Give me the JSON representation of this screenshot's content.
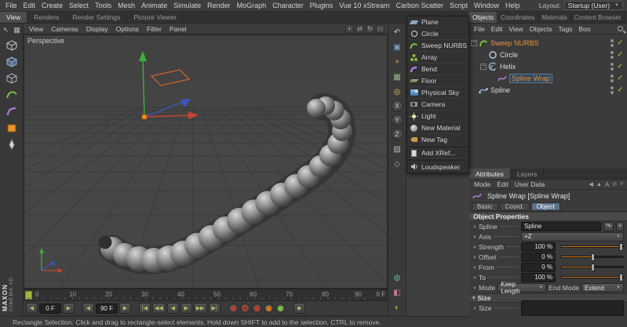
{
  "colors": {
    "accent_orange": "#e8942c",
    "selection_blue": "#31475c",
    "check_green": "#7cbf3f",
    "timeline_green": "#9db83c",
    "axis_red": "#c44436",
    "axis_green": "#3fae3c",
    "axis_blue": "#3a56c4"
  },
  "icons": {
    "check": "✓",
    "dropdown_arrow": "▼",
    "collapse": "−",
    "triangle_down": "▾",
    "left_arrow": "◀",
    "right_arrow": "▶",
    "goto_start": "|◀",
    "rewind": "◀◀",
    "play": "▶",
    "forward": "▶▶",
    "goto_end": "▶|",
    "undo": "↶",
    "pick_arrow": "↷",
    "diamond": "◆"
  },
  "menubar": {
    "items": [
      "File",
      "Edit",
      "Create",
      "Select",
      "Tools",
      "Mesh",
      "Animate",
      "Simulate",
      "Render",
      "MoGraph",
      "Character",
      "Plugins",
      "Vue 10 xStream",
      "Carbon Scatter",
      "Script",
      "Window",
      "Help"
    ],
    "layout_label": "Layout:",
    "layout_value": "Startup (User)"
  },
  "workspace_tabs": [
    "View",
    "Renders",
    "Render Settings",
    "Picture Viewer"
  ],
  "panel_tabs": [
    "Objects",
    "Coordinates",
    "Materials",
    "Content Browser"
  ],
  "viewport": {
    "menu": [
      "View",
      "Cameras",
      "Display",
      "Options",
      "Filter",
      "Panel"
    ],
    "camera_label": "Perspective",
    "toolbar_icons": [
      "move-view-icon",
      "pan-view-icon",
      "rotate-view-icon",
      "maximize-view-icon"
    ]
  },
  "left_toolbar": [
    "convert-object-icon",
    "cube-primitive-icon",
    "modeling-object-icon",
    "nurbs-object-icon",
    "deformer-object-icon",
    "scene-object-icon",
    "spline-pen-icon"
  ],
  "side_toolbar": {
    "icons": [
      "undo-icon",
      "frame-selection-icon",
      "add-object-icon",
      "grid-icon",
      "snap-icon",
      "texture-mode-icon",
      "axis-mode-icon",
      "camera-icon",
      "display-mode-icon",
      "render-region-icon"
    ],
    "axis_locks": [
      "X",
      "Y",
      "Z"
    ]
  },
  "popup_menu": {
    "items": [
      {
        "label": "Plane",
        "icon": "plane-icon"
      },
      {
        "label": "Circle",
        "icon": "circle-icon"
      },
      {
        "label": "Sweep NURBS",
        "icon": "sweep-nurbs-icon"
      },
      {
        "label": "Array",
        "icon": "array-icon"
      },
      {
        "label": "Bend",
        "icon": "bend-icon"
      },
      {
        "label": "Floor",
        "icon": "floor-icon"
      },
      {
        "label": "Physical Sky",
        "icon": "physical-sky-icon"
      },
      {
        "label": "Camera",
        "icon": "camera-icon"
      },
      {
        "label": "Light",
        "icon": "light-icon"
      },
      {
        "label": "New Material",
        "icon": "material-icon"
      },
      {
        "label": "New Tag",
        "icon": "tag-icon"
      },
      {
        "label": "Add XRef...",
        "icon": "xref-icon"
      },
      {
        "label": "Loudspeaker",
        "icon": "loudspeaker-icon"
      }
    ]
  },
  "object_manager": {
    "menu": [
      "File",
      "Edit",
      "View",
      "Objects",
      "Tags",
      "Boo"
    ],
    "tree": [
      {
        "label": "Sweep NURBS",
        "icon": "sweep-nurbs-icon",
        "depth": 0,
        "selected": true,
        "enabled": "check"
      },
      {
        "label": "Circle",
        "icon": "circle-icon",
        "depth": 1,
        "selected": false,
        "enabled": "check"
      },
      {
        "label": "Helix",
        "icon": "helix-icon",
        "depth": 1,
        "selected": false,
        "enabled": "check"
      },
      {
        "label": "Spline Wrap",
        "icon": "spline-wrap-icon",
        "depth": 2,
        "selected": true,
        "enabled": "check"
      },
      {
        "label": "Spline",
        "icon": "spline-icon",
        "depth": 0,
        "selected": false,
        "enabled": "check"
      }
    ]
  },
  "attributes": {
    "tabs": [
      "Attributes",
      "Layers"
    ],
    "menu": [
      "Mode",
      "Edit",
      "User Data"
    ],
    "title": "Spline Wrap [Spline Wrap]",
    "subtabs": [
      "Basic",
      "Coord.",
      "Object"
    ],
    "active_subtab": "Object",
    "section": "Object Properties",
    "fields": {
      "spline_label": "Spline",
      "spline_value": "Spline",
      "axis_label": "Axis",
      "axis_value": "+Z",
      "strength_label": "Strength",
      "strength_value": "100 %",
      "offset_label": "Offset",
      "offset_value": "0 %",
      "from_label": "From",
      "from_value": "0 %",
      "to_label": "To",
      "to_value": "100 %",
      "mode_label": "Mode",
      "mode_value": "Keep Length",
      "end_mode_label": "End Mode",
      "end_mode_value": "Extend",
      "size_section": "Size",
      "size_label": "Size"
    }
  },
  "timeline": {
    "ticks": [
      "0",
      "10",
      "20",
      "30",
      "40",
      "50",
      "60",
      "70",
      "80",
      "90"
    ],
    "end_label": "0 F",
    "current_frame": "0 F",
    "end_frame": "90 F"
  },
  "statusbar": {
    "text": "Rectangle Selection: Click and drag to rectangle-select elements. Hold down SHIFT to add to the selection, CTRL to remove."
  },
  "brand": {
    "line1": "MAXON",
    "line2": "CINEMA 4D"
  }
}
